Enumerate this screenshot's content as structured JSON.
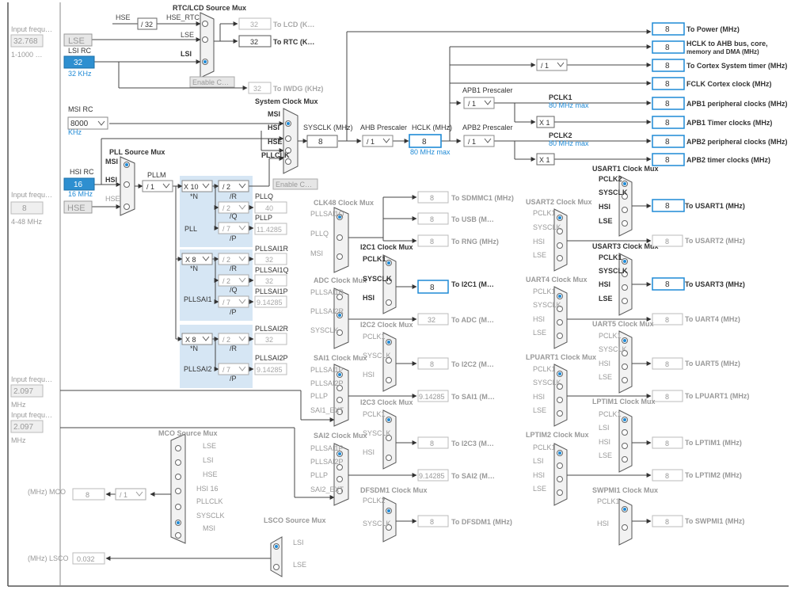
{
  "left_inputs": {
    "lse_freq_label": "Input frequ…",
    "lse_freq_value": "32.768",
    "lse_range": "1-1000 …",
    "hse_freq_label": "Input frequ…",
    "hse_freq_value": "8",
    "hse_range": "4-48 MHz",
    "ext1_label": "Input frequ…",
    "ext1_value": "2.097",
    "ext1_unit": "MHz",
    "ext2_label": "Input frequ…",
    "ext2_value": "2.097",
    "ext2_unit": "MHz"
  },
  "oscillators": {
    "lse": "LSE",
    "lsi_rc_label": "LSI RC",
    "lsi_value": "32",
    "lsi_sub": "32 KHz",
    "msi_rc_label": "MSI RC",
    "msi_value": "8000",
    "msi_unit": "KHz",
    "hsi_rc_label": "HSI RC",
    "hsi_value": "16",
    "hsi_sub": "16 MHz",
    "hse": "HSE"
  },
  "rtc": {
    "title": "RTC/LCD Source Mux",
    "hse_label": "HSE",
    "div32": "/ 32",
    "hse_rtc": "HSE_RTC",
    "lse_in": "LSE",
    "lsi_in": "LSI",
    "enable_css": "Enable C…",
    "lcd_value": "32",
    "lcd_label": "To LCD (K…",
    "rtc_value": "32",
    "rtc_label": "To RTC (K…",
    "iwdg_value": "32",
    "iwdg_label": "To IWDG (KHz)"
  },
  "sysclk_mux": {
    "title": "System Clock Mux",
    "in_msi": "MSI",
    "in_hsi": "HSI",
    "in_hse": "HSE",
    "in_pllclk": "PLLCLK",
    "enable_css": "Enable C…"
  },
  "sysclk": {
    "label": "SYSCLK (MHz)",
    "value": "8"
  },
  "ahb": {
    "label": "AHB Prescaler",
    "value": "/ 1"
  },
  "hclk": {
    "label": "HCLK (MHz)",
    "value": "8",
    "sub": "80 MHz max"
  },
  "outputs_top": {
    "power_value": "8",
    "power_label": "To Power (MHz)",
    "hclk_value": "8",
    "hclk_label": "HCLK to AHB bus, core,",
    "hclk_label2": "memory and DMA (MHz)",
    "cortex_div": "/ 1",
    "cortex_value": "8",
    "cortex_label": "To Cortex System timer (MHz)",
    "fclk_value": "8",
    "fclk_label": "FCLK Cortex clock (MHz)"
  },
  "apb1": {
    "prescaler_label": "APB1 Prescaler",
    "prescaler_value": "/ 1",
    "pclk_label": "PCLK1",
    "pclk_sub": "80 MHz max",
    "periph_value": "8",
    "periph_label": "APB1 peripheral clocks (MHz)",
    "x1": "X 1",
    "timer_value": "8",
    "timer_label": "APB1 Timer clocks (MHz)"
  },
  "apb2": {
    "prescaler_label": "APB2 Prescaler",
    "prescaler_value": "/ 1",
    "pclk_label": "PCLK2",
    "pclk_sub": "80 MHz max",
    "periph_value": "8",
    "periph_label": "APB2 peripheral clocks (MHz)",
    "x1": "X 1",
    "timer_value": "8",
    "timer_label": "APB2 timer clocks (MHz)"
  },
  "pll": {
    "src_title": "PLL Source Mux",
    "src_msi": "MSI",
    "src_hsi": "HSI",
    "src_hse": "HSE",
    "pllm_label": "PLLM",
    "pllm_value": "/ 1",
    "name": "PLL",
    "n_value": "X 10",
    "n_label": "*N",
    "r_value": "/ 2",
    "r_label": "/R",
    "q_value": "/ 2",
    "q_label": "/Q",
    "p_value": "/ 7",
    "p_label": "/P",
    "pllq_label": "PLLQ",
    "pllq_value": "40",
    "pllp_label": "PLLP",
    "pllp_value": "11.4285"
  },
  "pllsai1": {
    "name": "PLLSAI1",
    "n_value": "X 8",
    "n_label": "*N",
    "r_value": "/ 2",
    "r_label": "/R",
    "q_value": "/ 2",
    "q_label": "/Q",
    "p_value": "/ 7",
    "p_label": "/P",
    "r_out_label": "PLLSAI1R",
    "r_out_value": "32",
    "q_out_label": "PLLSAI1Q",
    "q_out_value": "32",
    "p_out_label": "PLLSAI1P",
    "p_out_value": "9.14285"
  },
  "pllsai2": {
    "name": "PLLSAI2",
    "n_value": "X 8",
    "n_label": "*N",
    "r_value": "/ 2",
    "r_label": "/R",
    "p_value": "/ 7",
    "p_label": "/P",
    "r_out_label": "PLLSAI2R",
    "r_out_value": "32",
    "p_out_label": "PLLSAI2P",
    "p_out_value": "9.14285"
  },
  "clk48": {
    "title": "CLK48 Clock Mux",
    "in1": "PLLSAI1Q",
    "in2": "PLLQ",
    "in3": "MSI",
    "sdmmc_value": "8",
    "sdmmc_label": "To SDMMC1 (MHz)",
    "usb_value": "8",
    "usb_label": "To USB (M…",
    "rng_value": "8",
    "rng_label": "To RNG (MHz)"
  },
  "adc": {
    "title": "ADC Clock Mux",
    "in1": "PLLSAI1R",
    "in2": "PLLSAI2R",
    "in3": "SYSCLK",
    "value": "32",
    "label": "To ADC (M…"
  },
  "sai1": {
    "title": "SAI1 Clock Mux",
    "in1": "PLLSAI1P",
    "in2": "PLLSAI2P",
    "in3": "PLLP",
    "in4": "SAI1_EXT",
    "value": "9.14285",
    "label": "To SAI1 (M…"
  },
  "sai2": {
    "title": "SAI2 Clock Mux",
    "in1": "PLLSAI1P",
    "in2": "PLLSAI2P",
    "in3": "PLLP",
    "in4": "SAI2_EXT",
    "value": "9.14285",
    "label": "To SAI2 (M…"
  },
  "i2c1": {
    "title": "I2C1 Clock Mux",
    "in1": "PCLK1",
    "in2": "SYSCLK",
    "in3": "HSI",
    "value": "8",
    "label": "To I2C1 (M…"
  },
  "i2c2": {
    "title": "I2C2 Clock Mux",
    "in1": "PCLK1",
    "in2": "SYSCLK",
    "in3": "HSI",
    "value": "8",
    "label": "To I2C2 (M…"
  },
  "i2c3": {
    "title": "I2C3 Clock Mux",
    "in1": "PCLK1",
    "in2": "SYSCLK",
    "in3": "HSI",
    "value": "8",
    "label": "To I2C3 (M…"
  },
  "dfsdm1": {
    "title": "DFSDM1 Clock Mux",
    "in1": "PCLK2",
    "in2": "SYSCLK",
    "value": "8",
    "label": "To DFSDM1 (MHz)"
  },
  "usart1": {
    "title": "USART1 Clock Mux",
    "in1": "PCLK2",
    "in2": "SYSCLK",
    "in3": "HSI",
    "in4": "LSE",
    "value": "8",
    "label": "To USART1 (MHz)"
  },
  "usart2": {
    "title": "USART2 Clock Mux",
    "in1": "PCLK1",
    "in2": "SYSCLK",
    "in3": "HSI",
    "in4": "LSE",
    "value": "8",
    "label": "To USART2 (MHz)"
  },
  "usart3": {
    "title": "USART3 Clock Mux",
    "in1": "PCLK1",
    "in2": "SYSCLK",
    "in3": "HSI",
    "in4": "LSE",
    "value": "8",
    "label": "To USART3 (MHz)"
  },
  "uart4": {
    "title": "UART4 Clock Mux",
    "in1": "PCLK1",
    "in2": "SYSCLK",
    "in3": "HSI",
    "in4": "LSE",
    "value": "8",
    "label": "To UART4 (MHz)"
  },
  "uart5": {
    "title": "UART5 Clock Mux",
    "in1": "PCLK1",
    "in2": "SYSCLK",
    "in3": "HSI",
    "in4": "LSE",
    "value": "8",
    "label": "To UART5 (MHz)"
  },
  "lpuart1": {
    "title": "LPUART1 Clock Mux",
    "in1": "PCLK1",
    "in2": "SYSCLK",
    "in3": "HSI",
    "in4": "LSE",
    "value": "8",
    "label": "To LPUART1 (MHz)"
  },
  "lptim1": {
    "title": "LPTIM1 Clock Mux",
    "in1": "PCLK1",
    "in2": "LSI",
    "in3": "HSI",
    "in4": "LSE",
    "value": "8",
    "label": "To LPTIM1 (MHz)"
  },
  "lptim2": {
    "title": "LPTIM2 Clock Mux",
    "in1": "PCLK1",
    "in2": "LSI",
    "in3": "HSI",
    "in4": "LSE",
    "value": "8",
    "label": "To LPTIM2 (MHz)"
  },
  "swpmi1": {
    "title": "SWPMI1 Clock Mux",
    "in1": "PCLK1",
    "in2": "HSI",
    "value": "8",
    "label": "To SWPMI1 (MHz)"
  },
  "mco": {
    "title": "MCO Source Mux",
    "in1": "LSE",
    "in2": "LSI",
    "in3": "HSE",
    "in4": "HSI 16",
    "in5": "PLLCLK",
    "in6": "SYSCLK",
    "in7": "MSI",
    "div": "/ 1",
    "value": "8",
    "label": "(MHz) MCO"
  },
  "lsco": {
    "title": "LSCO Source Mux",
    "in1": "LSI",
    "in2": "LSE",
    "value": "0.032",
    "label": "(MHz) LSCO"
  },
  "colors": {
    "blue_fill": "#2e8fd0",
    "blue_stroke": "#1f8ad6",
    "grey_text": "#a8a8a8",
    "pll_bg": "#d6e6f4"
  }
}
